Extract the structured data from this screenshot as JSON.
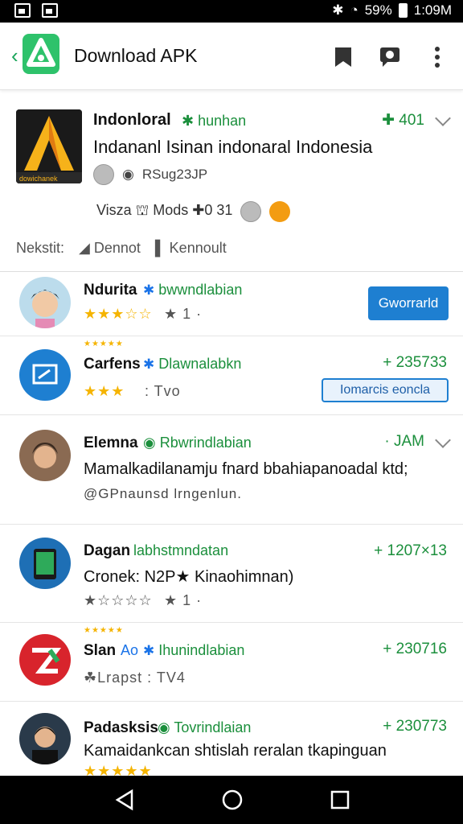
{
  "status": {
    "battery": "59%",
    "time": "1:09M"
  },
  "appbar": {
    "title": "Download APK"
  },
  "featured": {
    "name": "Indonloral",
    "verified": "hunhan",
    "count": "✚ 401",
    "description": "Indananl Isinan indonaral Indonesia",
    "meta_id": "RSug23JP",
    "stats": "Visza ⛫ Mods ✚0 31",
    "logo_caption": "dowichanek"
  },
  "filters": {
    "label": "Nekstit:",
    "f1": "Dennot",
    "f2": "Kennoult"
  },
  "rows": [
    {
      "name": "Ndurita",
      "tag": "bwwndlabian",
      "stars": "★★★☆☆",
      "meta": "★ 1 ·",
      "button": "Gworrarld"
    },
    {
      "name": "Carfens",
      "tag": "Dlawnalabkn",
      "stars": "★★★",
      "meta": ":   Tvo",
      "count": "+ 235733",
      "button": "Iomarcis eoncla",
      "top_stars": "★★★★★"
    },
    {
      "name": "Elemna",
      "tag": "Rbwrindlabian",
      "count": "· JAM",
      "desc": "Mamalkadilanamju fnard bbahiapanoadal ktd;",
      "meta": "@GPnaunsd lrngenlun."
    },
    {
      "name": "Dagan",
      "tag": "labhstmndatan",
      "count": "+ 1207×13",
      "desc": "Cronek: N2P★ Kinaohimnan)",
      "stars": "★☆☆☆☆",
      "meta": "★ 1 ·"
    },
    {
      "name": "Slan",
      "badge": "Ao",
      "tag": "Ihunindlabian",
      "count": "+ 230716",
      "meta": "☘Lrapst  :  TV4",
      "top_stars": "★★★★★"
    },
    {
      "name": "Padasksis",
      "tag": "Tovrindlaian",
      "count": "+ 230773",
      "desc": "Kamaidankcan shtislah reralan tkapinguan",
      "stars": "★★★★★"
    }
  ]
}
